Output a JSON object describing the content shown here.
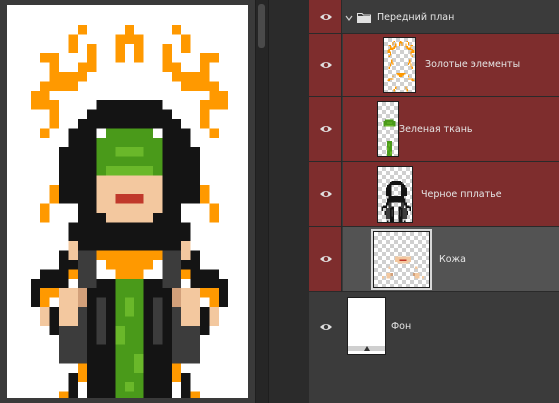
{
  "layers_panel": {
    "group": {
      "name": "Передний план",
      "icon": "folder-icon",
      "expanded": true,
      "visible": true
    },
    "layers": [
      {
        "name": "Золотые элементы",
        "highlight": "red",
        "thumb": "gold"
      },
      {
        "name": "Зеленая ткань",
        "highlight": "red",
        "thumb": "green"
      },
      {
        "name": "Черное пплатье",
        "highlight": "red",
        "thumb": "black"
      },
      {
        "name": "Кожа",
        "highlight": "red",
        "selected": true,
        "thumb": "skin"
      },
      {
        "name": "Фон",
        "highlight": "none",
        "thumb": "white"
      }
    ]
  },
  "colors": {
    "gold": "#ff9900",
    "gold_dark": "#e08a00",
    "green": "#4a9a1a",
    "green_light": "#6ab82a",
    "black_robe": "#141414",
    "gray_robe": "#3c3c3c",
    "skin": "#f3c89f",
    "skin_shadow": "#d2a07a",
    "layer_highlight": "#7e2d2d",
    "panel_bg": "#3b3b3b"
  }
}
